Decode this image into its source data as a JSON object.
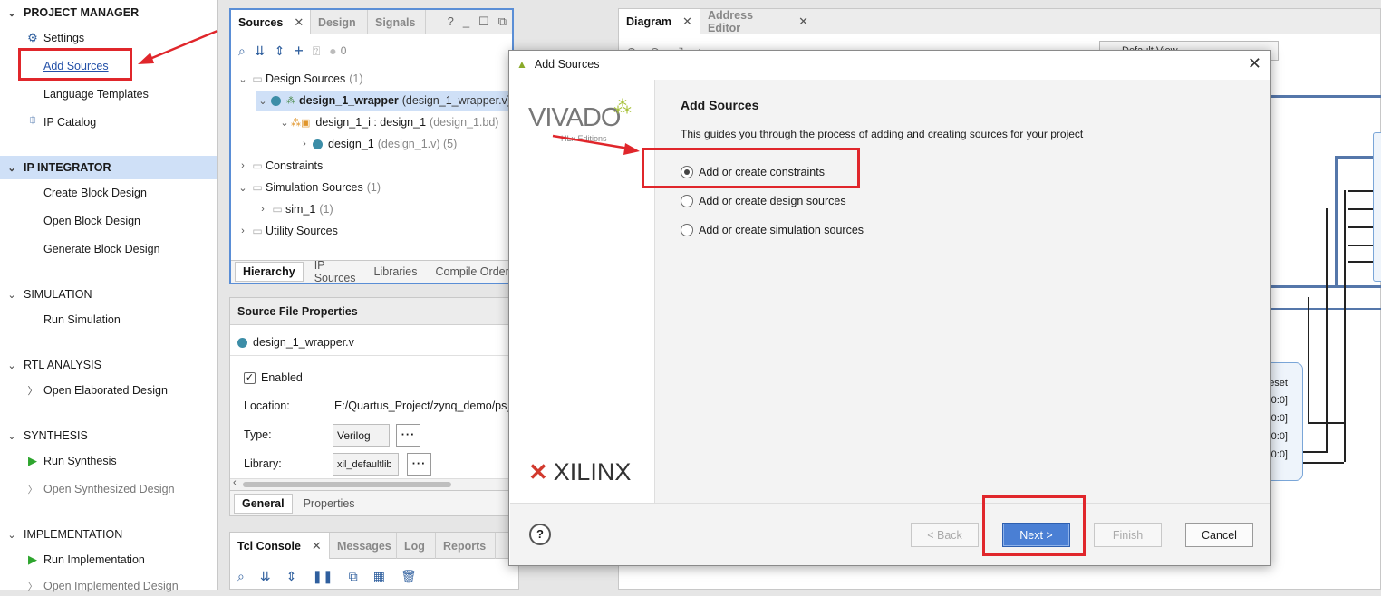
{
  "nav": {
    "project_manager": "PROJECT MANAGER",
    "settings": "Settings",
    "add_sources": "Add Sources",
    "language_templates": "Language Templates",
    "ip_catalog": "IP Catalog",
    "ip_integrator": "IP INTEGRATOR",
    "create_block_design": "Create Block Design",
    "open_block_design": "Open Block Design",
    "generate_block_design": "Generate Block Design",
    "simulation": "SIMULATION",
    "run_simulation": "Run Simulation",
    "rtl_analysis": "RTL ANALYSIS",
    "open_elaborated_design": "Open Elaborated Design",
    "synthesis": "SYNTHESIS",
    "run_synthesis": "Run Synthesis",
    "open_synthesized_design": "Open Synthesized Design",
    "implementation": "IMPLEMENTATION",
    "run_implementation": "Run Implementation",
    "open_implemented_design": "Open Implemented Design"
  },
  "sources": {
    "tabs": [
      "Sources",
      "Design",
      "Signals"
    ],
    "toolbar_count": "0",
    "tree": {
      "design_sources": "Design Sources",
      "design_sources_count": "(1)",
      "wrapper": "design_1_wrapper",
      "wrapper_file": "(design_1_wrapper.v)",
      "inst": "design_1_i : design_1",
      "inst_file": "(design_1.bd)",
      "design_1": "design_1",
      "design_1_file": "(design_1.v) (5)",
      "constraints": "Constraints",
      "simulation_sources": "Simulation Sources",
      "simulation_sources_count": "(1)",
      "sim_1": "sim_1",
      "sim_1_count": "(1)",
      "utility_sources": "Utility Sources"
    },
    "bottom_tabs": [
      "Hierarchy",
      "IP Sources",
      "Libraries",
      "Compile Order"
    ]
  },
  "props": {
    "title": "Source File Properties",
    "file": "design_1_wrapper.v",
    "enabled": "Enabled",
    "location_label": "Location:",
    "location_value": "E:/Quartus_Project/zynq_demo/ps_",
    "type_label": "Type:",
    "type_value": "Verilog",
    "library_label": "Library:",
    "library_value": "xil_defaultlib",
    "dots": "···",
    "tabs": [
      "General",
      "Properties"
    ]
  },
  "tcl": {
    "tabs": [
      "Tcl Console",
      "Messages",
      "Log",
      "Reports"
    ]
  },
  "diagram": {
    "tabs": [
      "Diagram",
      "Address Editor"
    ],
    "view_select": "Default View",
    "ports": [
      "reset",
      "t[0:0]",
      "t[0:0]",
      "n[0:0]",
      "n[0:0]"
    ]
  },
  "dialog": {
    "title": "Add Sources",
    "heading": "Add Sources",
    "description": "This guides you through the process of adding and creating sources for your project",
    "options": [
      {
        "label": "Add or create constraints",
        "selected": true
      },
      {
        "label": "Add or create design sources",
        "selected": false
      },
      {
        "label": "Add or create simulation sources",
        "selected": false
      }
    ],
    "vivado_logo": "VIVADO",
    "vivado_sub": "HLx Editions",
    "xilinx_logo": "XILINX",
    "help": "?",
    "back": "< Back",
    "next": "Next >",
    "finish": "Finish",
    "cancel": "Cancel"
  },
  "colors": {
    "annotation_red": "#e0262b",
    "selection_blue": "#cfe0f7",
    "primary_button": "#4a7fd4"
  }
}
